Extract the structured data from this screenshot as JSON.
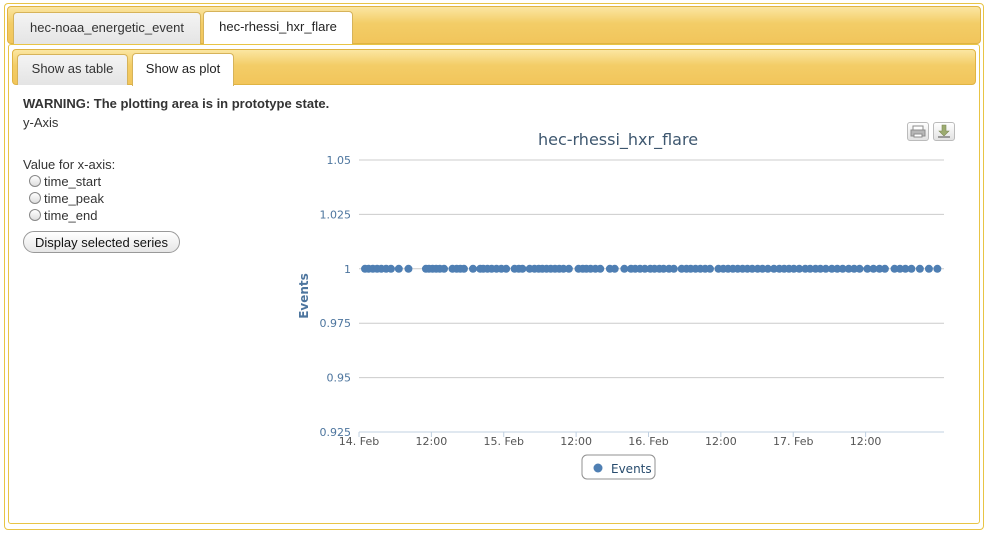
{
  "tabs": [
    {
      "label": "hec-noaa_energetic_event",
      "active": false
    },
    {
      "label": "hec-rhessi_hxr_flare",
      "active": true
    }
  ],
  "subtabs": [
    {
      "label": "Show as table",
      "active": false
    },
    {
      "label": "Show as plot",
      "active": true
    }
  ],
  "warning": "WARNING: The plotting area is in prototype state.",
  "y_axis_label": "y-Axis",
  "x_axis_title": "Value for x-axis:",
  "x_axis_options": [
    "time_start",
    "time_peak",
    "time_end"
  ],
  "display_button": "Display selected series",
  "toolbar": {
    "print_icon": "print-icon",
    "export_icon": "download-icon"
  },
  "colors": {
    "series": "#4f7fb3",
    "tab_bar": "#f3cd67",
    "border": "#e8c445"
  },
  "chart_data": {
    "type": "scatter",
    "title": "hec-rhessi_hxr_flare",
    "xlabel": "",
    "ylabel": "Events",
    "ylim": [
      0.925,
      1.05
    ],
    "y_ticks": [
      "0.925",
      "0.95",
      "0.975",
      "1",
      "1.025",
      "1.05"
    ],
    "x_ticks": [
      "14. Feb",
      "12:00",
      "15. Feb",
      "12:00",
      "16. Feb",
      "12:00",
      "17. Feb",
      "12:00"
    ],
    "grid": true,
    "legend": "bottom-center",
    "series": [
      {
        "name": "Events",
        "color": "#4f7fb3",
        "y": 1,
        "x_hours": [
          1.0,
          1.6,
          2.3,
          3.0,
          3.7,
          4.5,
          5.3,
          6.6,
          8.2,
          11.1,
          11.6,
          12.2,
          12.8,
          13.4,
          14.1,
          15.5,
          16.2,
          16.8,
          17.4,
          18.9,
          20.1,
          20.6,
          21.3,
          22.0,
          22.8,
          23.6,
          24.4,
          25.8,
          26.5,
          27.1,
          28.3,
          29.1,
          29.8,
          30.4,
          31.1,
          31.8,
          32.5,
          33.2,
          33.9,
          34.8,
          36.4,
          37.1,
          37.7,
          38.4,
          39.2,
          40.0,
          41.6,
          42.4,
          44.0,
          45.1,
          45.8,
          46.6,
          47.4,
          48.3,
          49.0,
          49.8,
          50.5,
          51.4,
          52.2,
          53.5,
          54.3,
          55.0,
          55.8,
          56.6,
          57.4,
          58.2,
          59.6,
          60.4,
          61.2,
          62.0,
          62.8,
          63.6,
          64.4,
          65.2,
          66.1,
          66.9,
          67.8,
          68.8,
          69.7,
          70.5,
          71.3,
          72.1,
          73.0,
          74.0,
          74.8,
          75.7,
          76.5,
          77.4,
          78.4,
          79.3,
          80.2,
          81.2,
          82.1,
          83.0,
          84.3,
          85.3,
          86.3,
          87.2,
          88.8,
          89.7,
          90.6,
          91.6,
          93.0,
          94.5,
          95.9
        ]
      }
    ]
  }
}
